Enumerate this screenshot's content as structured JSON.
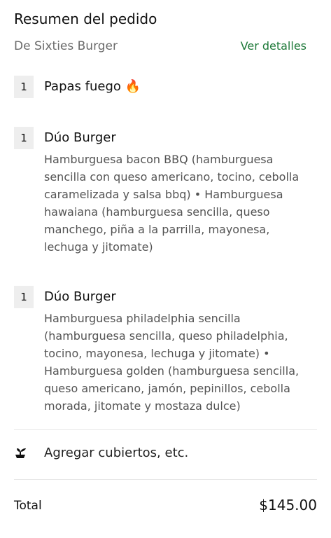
{
  "header": {
    "title": "Resumen del pedido"
  },
  "restaurant": {
    "name": "De Sixties Burger",
    "details_link": "Ver detalles",
    "link_color": "#1f7a3a"
  },
  "items": [
    {
      "quantity": "1",
      "name": "Papas fuego 🔥",
      "description": ""
    },
    {
      "quantity": "1",
      "name": "Dúo Burger",
      "description": "Hamburguesa bacon BBQ  (hamburguesa sencilla con queso americano, tocino, cebolla caramelizada y salsa bbq) • Hamburguesa hawaiana (hamburguesa sencilla, queso manchego, piña a la parrilla, mayonesa, lechuga y jitomate)"
    },
    {
      "quantity": "1",
      "name": "Dúo Burger",
      "description": "Hamburguesa philadelphia sencilla (hamburguesa sencilla, queso philadelphia, tocino, mayonesa, lechuga y jitomate) • Hamburguesa golden (hamburguesa sencilla, queso americano, jamón, pepinillos, cebolla morada, jitomate y mostaza dulce)"
    }
  ],
  "utensils": {
    "icon": "utensils-icon",
    "label": "Agregar cubiertos, etc."
  },
  "total": {
    "label": "Total",
    "value": "$145.00"
  }
}
